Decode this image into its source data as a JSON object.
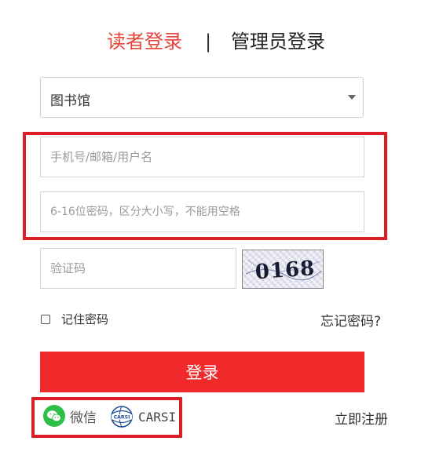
{
  "tabs": {
    "reader": "读者登录",
    "separator": "|",
    "admin": "管理员登录"
  },
  "library_select": {
    "value": "图书馆"
  },
  "fields": {
    "username_placeholder": "手机号/邮箱/用户名",
    "password_placeholder": "6-16位密码，区分大小写，不能用空格",
    "captcha_placeholder": "验证码"
  },
  "captcha": {
    "text": "0168"
  },
  "remember": {
    "label": "记住密码",
    "checked": false
  },
  "forgot_label": "忘记密码?",
  "login_label": "登录",
  "social": {
    "wechat_label": "微信",
    "carsi_label": "CARSI",
    "carsi_icon_text": "CARSI"
  },
  "register_label": "立即注册",
  "colors": {
    "accent": "#e8443a",
    "button": "#f02a2a",
    "highlight_box": "#dc1f26",
    "wechat": "#2fbf48",
    "carsi": "#1d4f91"
  }
}
